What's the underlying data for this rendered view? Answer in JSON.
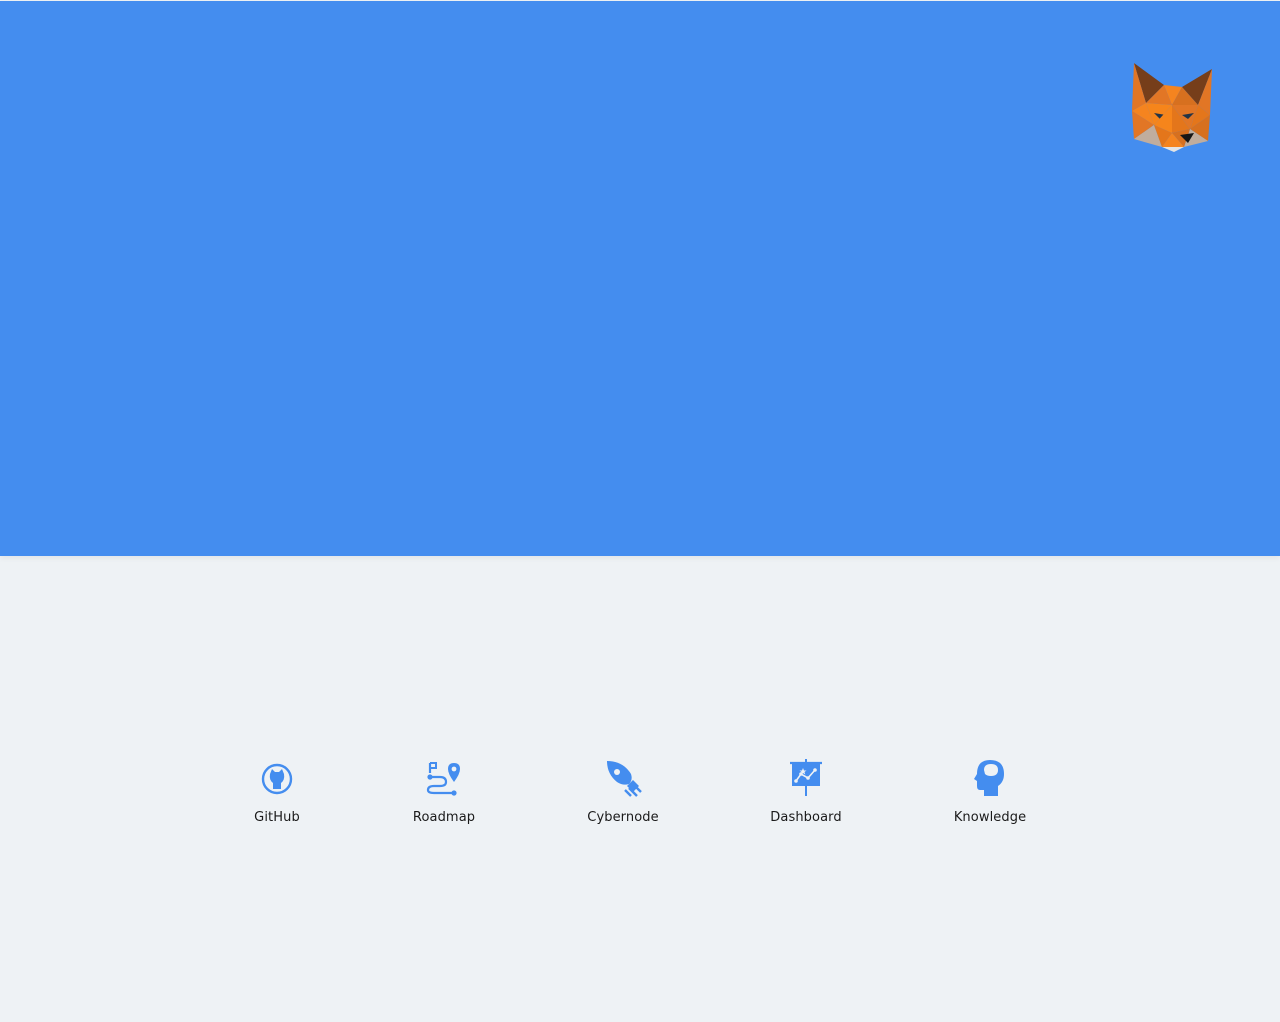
{
  "colors": {
    "hero_background": "#448def",
    "page_background": "#eef2f5",
    "icon_accent": "#448def",
    "label_text": "#1a1a1a"
  },
  "hero": {
    "logo_icon": "metamask-fox-icon"
  },
  "links": [
    {
      "label": "GitHub",
      "icon": "github-icon"
    },
    {
      "label": "Roadmap",
      "icon": "roadmap-icon"
    },
    {
      "label": "Cybernode",
      "icon": "rocket-icon"
    },
    {
      "label": "Dashboard",
      "icon": "dashboard-icon"
    },
    {
      "label": "Knowledge",
      "icon": "knowledge-head-icon"
    }
  ]
}
